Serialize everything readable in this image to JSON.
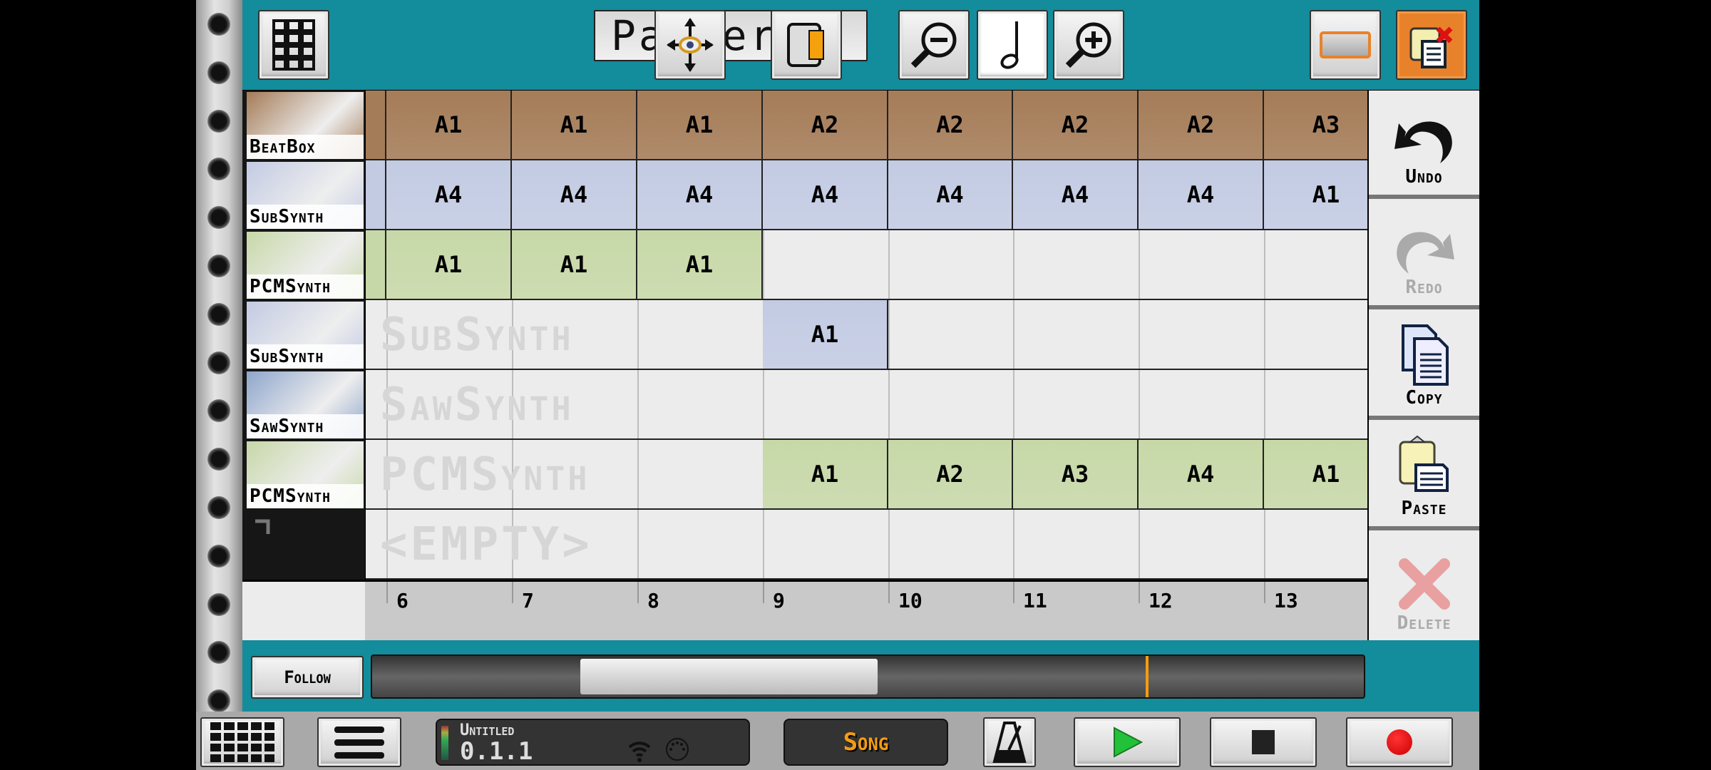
{
  "toolbar": {
    "title": "Patterns",
    "buttons": [
      "pattern-grid",
      "move-view",
      "toggle-panel",
      "zoom-out",
      "note-snap",
      "zoom-in",
      "select-rect",
      "paste-clear"
    ]
  },
  "tracks": [
    {
      "name": "BeatBox",
      "color": "#a57c58",
      "cells": [
        "A1",
        "A1",
        "A1",
        "A2",
        "A2",
        "A2",
        "A2",
        "A3"
      ],
      "lead": true,
      "watermark": ""
    },
    {
      "name": "SubSynth",
      "color": "#c3cbe3",
      "cells": [
        "A4",
        "A4",
        "A4",
        "A4",
        "A4",
        "A4",
        "A4",
        "A1"
      ],
      "lead": true,
      "watermark": ""
    },
    {
      "name": "PCMSynth",
      "color": "#c7d8a8",
      "cells": [
        "A1",
        "A1",
        "A1",
        null,
        null,
        null,
        null,
        null
      ],
      "lead": true,
      "watermark": ""
    },
    {
      "name": "SubSynth",
      "color": "#c3cbe3",
      "cells": [
        null,
        null,
        null,
        "A1",
        null,
        null,
        null,
        null
      ],
      "lead": false,
      "watermark": "SubSynth"
    },
    {
      "name": "SawSynth",
      "color": "#8fa6cc",
      "cells": [
        null,
        null,
        null,
        null,
        null,
        null,
        null,
        null
      ],
      "lead": false,
      "watermark": "SawSynth"
    },
    {
      "name": "PCMSynth",
      "color": "#c7d8a8",
      "cells": [
        null,
        null,
        null,
        "A1",
        "A2",
        "A3",
        "A4",
        "A1"
      ],
      "lead": false,
      "watermark": "PCMSynth"
    },
    {
      "name": "",
      "color": "",
      "cells": [
        null,
        null,
        null,
        null,
        null,
        null,
        null,
        null
      ],
      "lead": false,
      "watermark": "<EMPTY>"
    }
  ],
  "ruler": [
    "6",
    "7",
    "8",
    "9",
    "10",
    "11",
    "12",
    "13"
  ],
  "side": {
    "undo": "Undo",
    "redo": "Redo",
    "copy": "Copy",
    "paste": "Paste",
    "delete": "Delete"
  },
  "scroll": {
    "follow": "Follow",
    "thumb_start_pct": 21,
    "thumb_end_pct": 51,
    "playhead_pct": 78
  },
  "status": {
    "song_name": "Untitled",
    "position": "0.1.1",
    "mode": "Song"
  },
  "colors": {
    "teal": "#138c9b",
    "mode_text": "#f39c12",
    "play": "#22c13a",
    "record": "#e00000"
  }
}
